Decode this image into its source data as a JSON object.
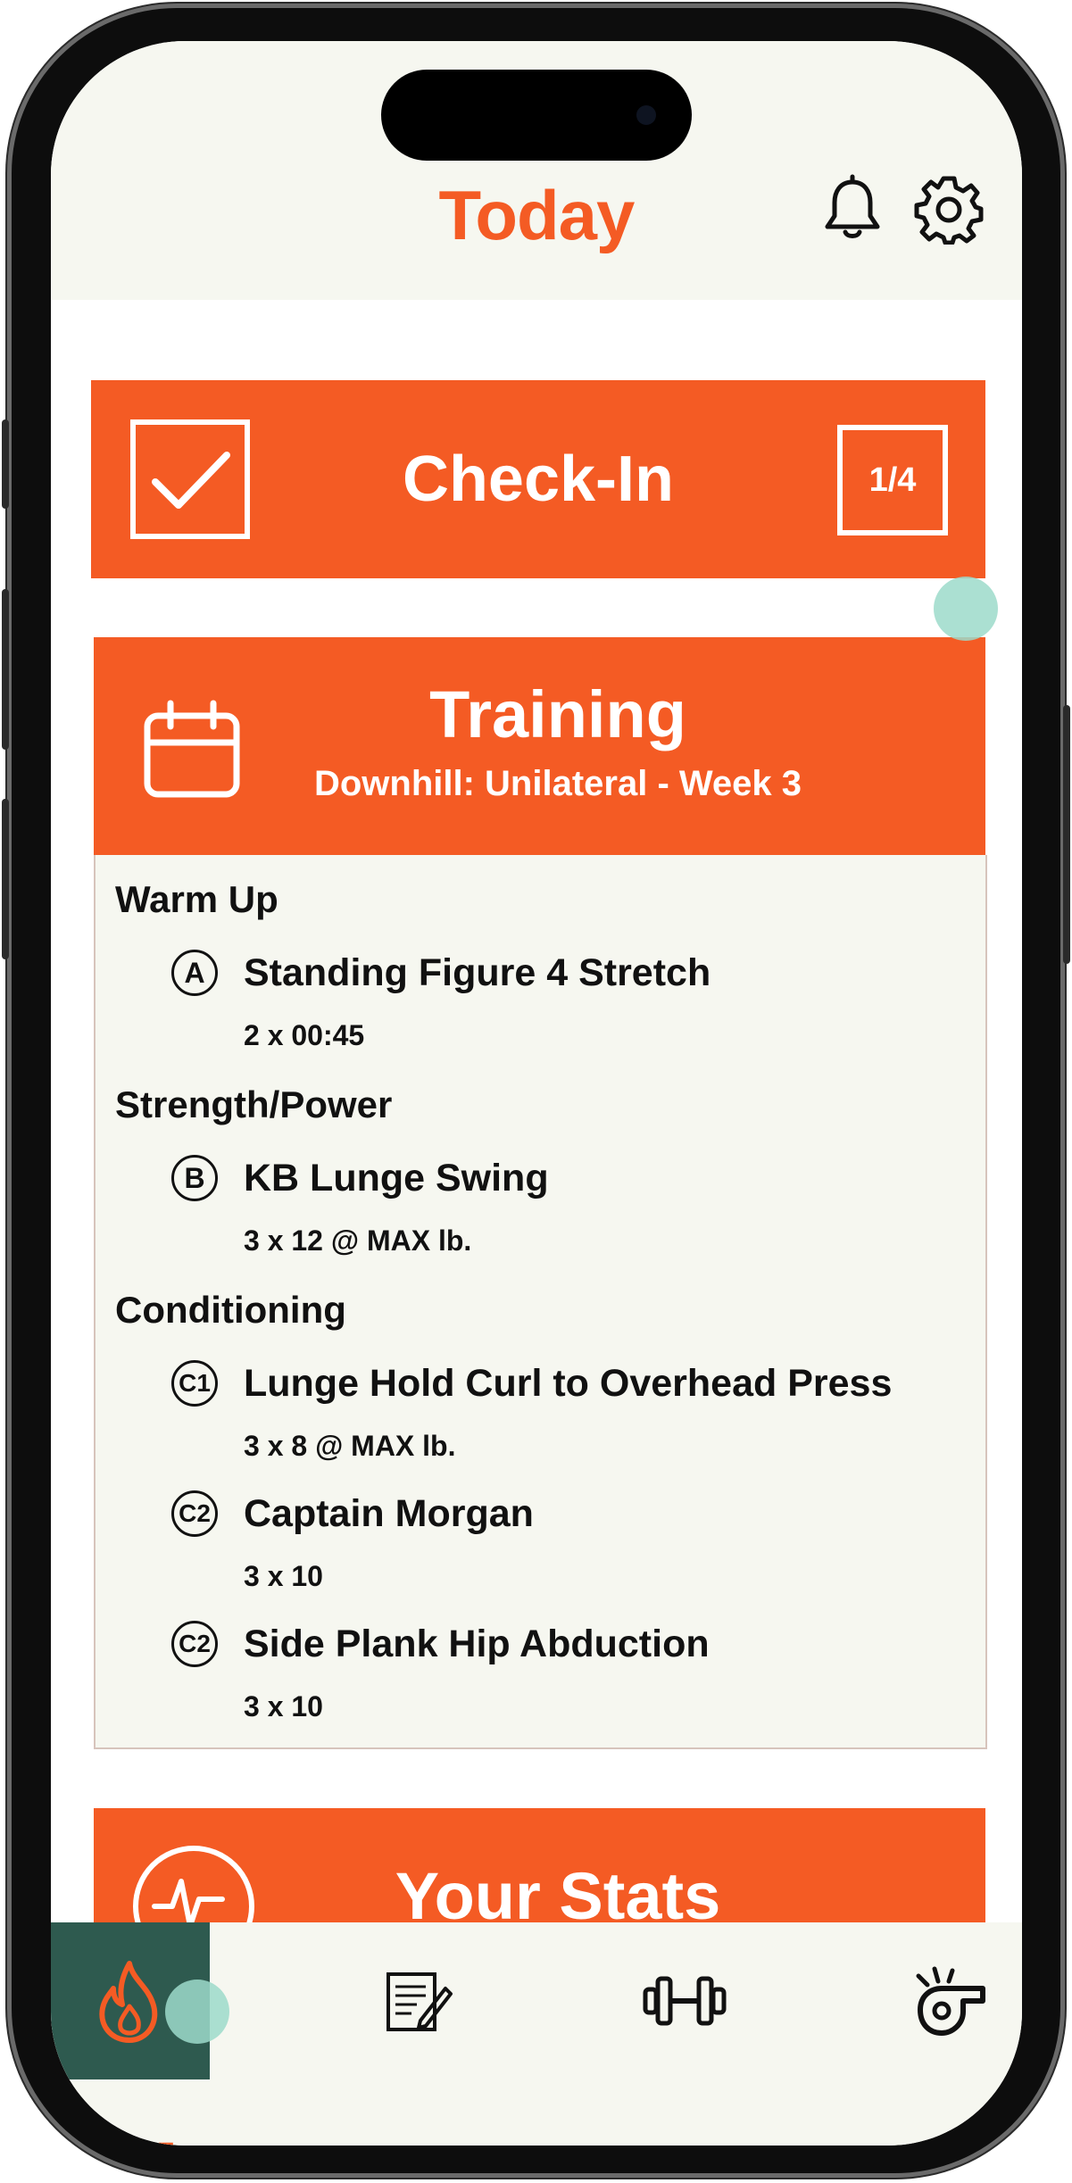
{
  "header": {
    "title": "Today"
  },
  "checkin": {
    "title": "Check-In",
    "progress": "1/4"
  },
  "training": {
    "title": "Training",
    "subtitle": "Downhill: Unilateral - Week 3",
    "sections": [
      {
        "label": "Warm Up",
        "exercises": [
          {
            "badge": "A",
            "name": "Standing Figure 4 Stretch",
            "detail": "2 x 00:45"
          }
        ]
      },
      {
        "label": "Strength/Power",
        "exercises": [
          {
            "badge": "B",
            "name": "KB Lunge Swing",
            "detail": "3 x 12 @ MAX lb."
          }
        ]
      },
      {
        "label": "Conditioning",
        "exercises": [
          {
            "badge": "C1",
            "name": "Lunge Hold Curl to Overhead Press",
            "detail": "3 x 8 @ MAX lb."
          },
          {
            "badge": "C2",
            "name": "Captain Morgan",
            "detail": "3 x 10"
          },
          {
            "badge": "C2",
            "name": "Side Plank Hip Abduction",
            "detail": "3 x 10"
          }
        ]
      }
    ]
  },
  "stats": {
    "title": "Your Stats"
  },
  "tabbar": {
    "tabs": [
      {
        "icon": "flame-icon",
        "active": true
      },
      {
        "icon": "notes-icon",
        "active": false
      },
      {
        "icon": "dumbbell-icon",
        "active": false
      },
      {
        "icon": "whistle-icon",
        "active": false
      }
    ]
  },
  "colors": {
    "accent": "#f45b24",
    "active_tab": "#2e5a4f",
    "background": "#f6f7f0"
  }
}
